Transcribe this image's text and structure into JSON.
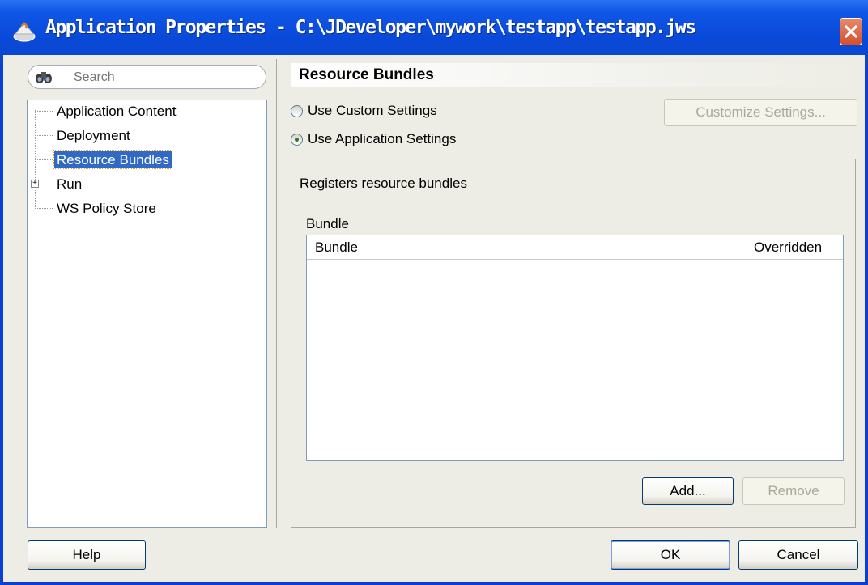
{
  "window": {
    "title": "Application Properties - C:\\JDeveloper\\mywork\\testapp\\testapp.jws"
  },
  "search": {
    "placeholder": "Search"
  },
  "tree": {
    "items": [
      {
        "label": "Application Content"
      },
      {
        "label": "Deployment"
      },
      {
        "label": "Resource Bundles",
        "selected": true
      },
      {
        "label": "Run",
        "expandable": true
      },
      {
        "label": "WS Policy Store"
      }
    ]
  },
  "panel": {
    "title": "Resource Bundles",
    "radio_custom": "Use Custom Settings",
    "radio_app": "Use Application Settings",
    "selected_radio": "Use Application Settings",
    "customize_button": "Customize Settings...",
    "description": "Registers resource bundles",
    "bundle_label": "Bundle",
    "table": {
      "columns": [
        "Bundle",
        "Overridden"
      ],
      "rows": []
    },
    "add_button": "Add...",
    "remove_button": "Remove"
  },
  "footer": {
    "help_button": "Help",
    "ok_button": "OK",
    "cancel_button": "Cancel"
  },
  "colors": {
    "titlebar": "#0a49d8",
    "selection": "#316ac5",
    "dialog_bg": "#eeede5"
  }
}
